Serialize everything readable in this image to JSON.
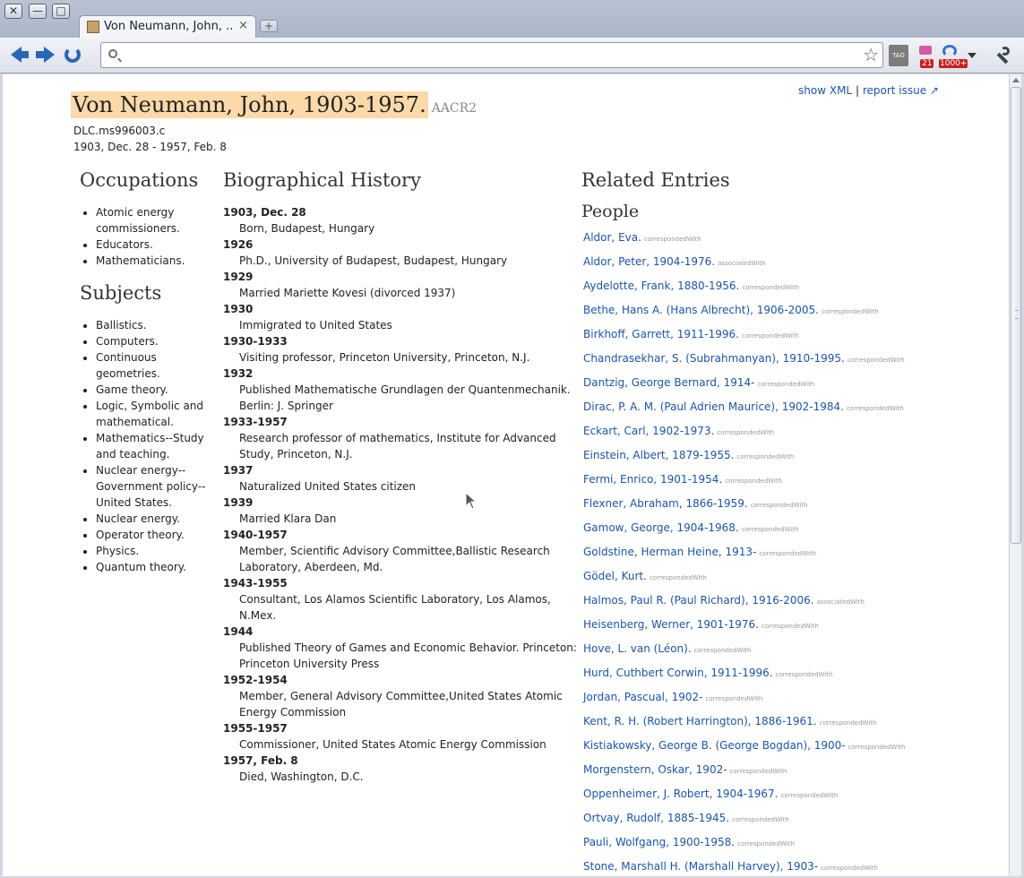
{
  "browser": {
    "tab_title": "Von Neumann, John, ...",
    "tab_close": "×",
    "new_tab": "+",
    "omnibox_value": "",
    "ext_tag_label": "TAG",
    "ext_21_badge": "21",
    "ext_1000_badge": "1000+",
    "window_close": "✕",
    "window_min": "—",
    "window_max": "□"
  },
  "page": {
    "show_xml": "show XML",
    "separator": "|",
    "report_issue": "report issue ↗",
    "name": "Von Neumann, John, 1903-1957.",
    "rules": "AACR2",
    "ark": "DLC.ms996003.c",
    "dates": "1903, Dec. 28 - 1957, Feb. 8",
    "occupations_heading": "Occupations",
    "occupations": [
      "Atomic energy commissioners.",
      "Educators.",
      "Mathematicians."
    ],
    "subjects_heading": "Subjects",
    "subjects": [
      "Ballistics.",
      "Computers.",
      "Continuous geometries.",
      "Game theory.",
      "Logic, Symbolic and mathematical.",
      "Mathematics--Study and teaching.",
      "Nuclear energy--Government policy--United States.",
      "Nuclear energy.",
      "Operator theory.",
      "Physics.",
      "Quantum theory."
    ],
    "bio_heading": "Biographical History",
    "bio": [
      {
        "date": "1903, Dec. 28",
        "event": "Born, Budapest, Hungary"
      },
      {
        "date": "1926",
        "event": "Ph.D., University of Budapest, Budapest, Hungary"
      },
      {
        "date": "1929",
        "event": "Married Mariette Kovesi (divorced 1937)"
      },
      {
        "date": "1930",
        "event": "Immigrated to United States"
      },
      {
        "date": "1930-1933",
        "event": "Visiting professor, Princeton University, Princeton, N.J."
      },
      {
        "date": "1932",
        "event": "Published Mathematische Grundlagen der Quantenmechanik. Berlin: J. Springer"
      },
      {
        "date": "1933-1957",
        "event": "Research professor of mathematics, Institute for Advanced Study, Princeton, N.J."
      },
      {
        "date": "1937",
        "event": "Naturalized United States citizen"
      },
      {
        "date": "1939",
        "event": "Married Klara Dan"
      },
      {
        "date": "1940-1957",
        "event": "Member, Scientific Advisory Committee,Ballistic Research Laboratory, Aberdeen, Md."
      },
      {
        "date": "1943-1955",
        "event": "Consultant, Los Alamos Scientific Laboratory, Los Alamos, N.Mex."
      },
      {
        "date": "1944",
        "event": "Published Theory of Games and Economic Behavior. Princeton: Princeton University Press"
      },
      {
        "date": "1952-1954",
        "event": "Member, General Advisory Committee,United States Atomic Energy Commission"
      },
      {
        "date": "1955-1957",
        "event": "Commissioner, United States Atomic Energy Commission"
      },
      {
        "date": "1957, Feb. 8",
        "event": "Died, Washington, D.C."
      }
    ],
    "related_heading": "Related Entries",
    "people_heading": "People",
    "people": [
      {
        "name": "Aldor, Eva.",
        "rel": "correspondedWith"
      },
      {
        "name": "Aldor, Peter, 1904-1976.",
        "rel": "associatedWith"
      },
      {
        "name": "Aydelotte, Frank, 1880-1956.",
        "rel": "correspondedWith"
      },
      {
        "name": "Bethe, Hans A. (Hans Albrecht), 1906-2005.",
        "rel": "correspondedWith"
      },
      {
        "name": "Birkhoff, Garrett, 1911-1996.",
        "rel": "correspondedWith"
      },
      {
        "name": "Chandrasekhar, S. (Subrahmanyan), 1910-1995.",
        "rel": "correspondedWith"
      },
      {
        "name": "Dantzig, George Bernard, 1914-",
        "rel": "correspondedWith"
      },
      {
        "name": "Dirac, P. A. M. (Paul Adrien Maurice), 1902-1984.",
        "rel": "correspondedWith"
      },
      {
        "name": "Eckart, Carl, 1902-1973.",
        "rel": "correspondedWith"
      },
      {
        "name": "Einstein, Albert, 1879-1955.",
        "rel": "correspondedWith"
      },
      {
        "name": "Fermi, Enrico, 1901-1954.",
        "rel": "correspondedWith"
      },
      {
        "name": "Flexner, Abraham, 1866-1959.",
        "rel": "correspondedWith"
      },
      {
        "name": "Gamow, George, 1904-1968.",
        "rel": "correspondedWith"
      },
      {
        "name": "Goldstine, Herman Heine, 1913-",
        "rel": "correspondedWith"
      },
      {
        "name": "Gödel, Kurt.",
        "rel": "correspondedWith"
      },
      {
        "name": "Halmos, Paul R. (Paul Richard), 1916-2006.",
        "rel": "associatedWith"
      },
      {
        "name": "Heisenberg, Werner, 1901-1976.",
        "rel": "correspondedWith"
      },
      {
        "name": "Hove, L. van (Léon).",
        "rel": "correspondedWith"
      },
      {
        "name": "Hurd, Cuthbert Corwin, 1911-1996.",
        "rel": "correspondedWith"
      },
      {
        "name": "Jordan, Pascual, 1902-",
        "rel": "correspondedWith"
      },
      {
        "name": "Kent, R. H. (Robert Harrington), 1886-1961.",
        "rel": "correspondedWith"
      },
      {
        "name": "Kistiakowsky, George B. (George Bogdan), 1900-",
        "rel": "correspondedWith"
      },
      {
        "name": "Morgenstern, Oskar, 1902-",
        "rel": "correspondedWith"
      },
      {
        "name": "Oppenheimer, J. Robert, 1904-1967.",
        "rel": "correspondedWith"
      },
      {
        "name": "Ortvay, Rudolf, 1885-1945.",
        "rel": "correspondedWith"
      },
      {
        "name": "Pauli, Wolfgang, 1900-1958.",
        "rel": "correspondedWith"
      },
      {
        "name": "Stone, Marshall H. (Marshall Harvey), 1903-",
        "rel": "correspondedWith"
      }
    ]
  }
}
